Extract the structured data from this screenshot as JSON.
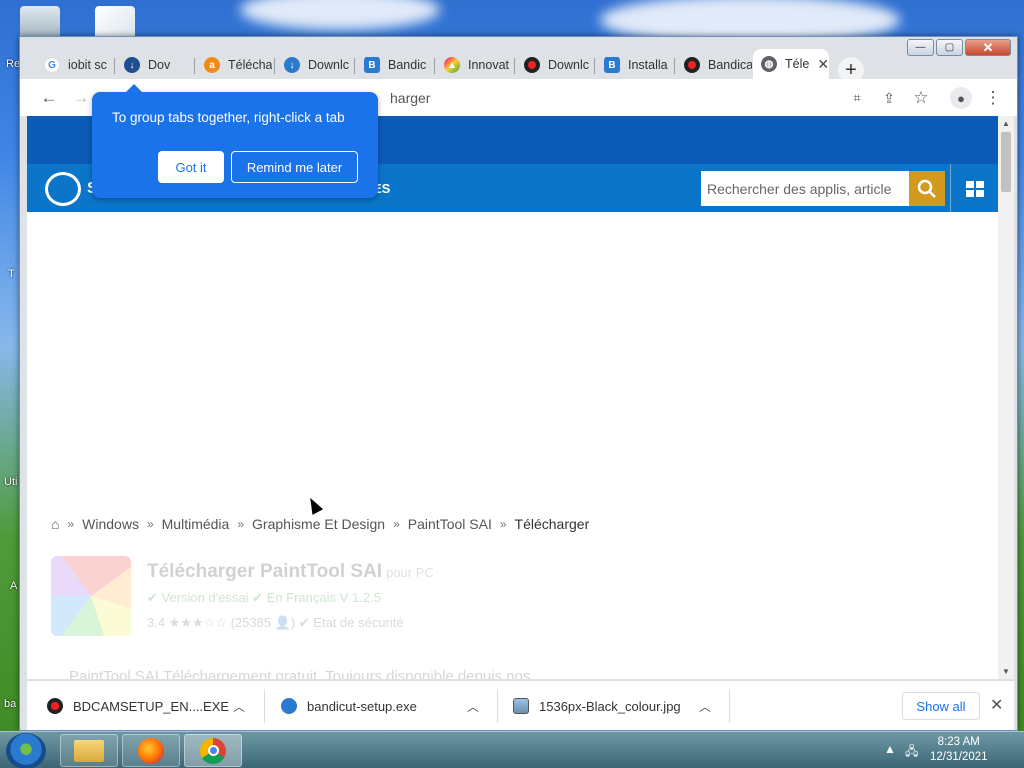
{
  "desktop": {
    "labels": [
      "Re",
      "T",
      "Uti",
      "A",
      "ba"
    ]
  },
  "browser": {
    "tabs": [
      {
        "label": "iobit sc",
        "icon": "google-icon",
        "color": "#4285f4"
      },
      {
        "label": "Dov",
        "icon": "download-icon",
        "color": "#1d4f91"
      },
      {
        "label": "Télécha",
        "icon": "avast-icon",
        "color": "#f28a1a"
      },
      {
        "label": "Downlc",
        "icon": "download-icon",
        "color": "#2a7ad0"
      },
      {
        "label": "Bandic",
        "icon": "bandicam-icon",
        "color": "#2a7ad0"
      },
      {
        "label": "Innovat",
        "icon": "innovat-icon",
        "color": "#e07"
      },
      {
        "label": "Downlc",
        "icon": "record-icon",
        "color": "#c00"
      },
      {
        "label": "Installa",
        "icon": "bandicam-icon",
        "color": "#2a7ad0"
      },
      {
        "label": "Bandica",
        "icon": "record-icon",
        "color": "#c00"
      },
      {
        "label": "Téle",
        "icon": "globe-icon",
        "color": "#5f6368",
        "active": true
      }
    ],
    "omnibox_text": "harger",
    "window_buttons": {
      "minimize": "—",
      "maximize": "▢",
      "close": "✕"
    }
  },
  "tooltip": {
    "text": "To group tabs together, right-click a tab",
    "got_it": "Got it",
    "remind": "Remind me later"
  },
  "site": {
    "logo_partial": "S",
    "nav_partial": "ES",
    "search_placeholder": "Rechercher des applis, article",
    "breadcrumb": [
      "Windows",
      "Multimédia",
      "Graphisme Et Design",
      "PaintTool SAI",
      "Télécharger"
    ],
    "app": {
      "title": "Télécharger PaintTool SAI",
      "title_suffix": "pour PC",
      "meta": "✔ Version d'essai  ✔ En Français  V 1.2.5",
      "rating": "3.4 ★★★☆☆ (25385 👤)  ✔ Etat de sécurité",
      "desc": "PaintTool SAI Téléchargement gratuit. Toujours disponible depuis nos"
    }
  },
  "downloads": {
    "items": [
      {
        "name": "BDCAMSETUP_EN....EXE",
        "color": "#c00"
      },
      {
        "name": "bandicut-setup.exe",
        "color": "#2a7ad0"
      },
      {
        "name": "1536px-Black_colour.jpg",
        "color": "#555"
      }
    ],
    "show_all": "Show all"
  },
  "taskbar": {
    "time": "8:23 AM",
    "date": "12/31/2021"
  }
}
